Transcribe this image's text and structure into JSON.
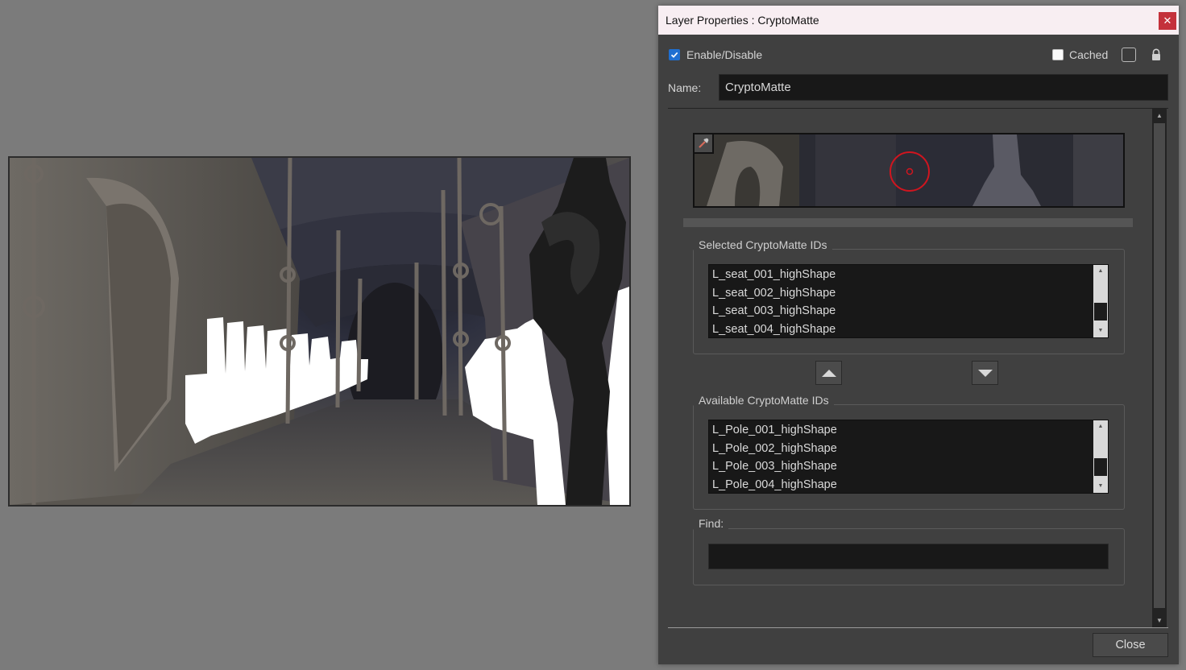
{
  "dialog": {
    "title": "Layer Properties : CryptoMatte",
    "enable_label": "Enable/Disable",
    "enable_checked": true,
    "cached_label": "Cached",
    "cached_checked": false,
    "name_label": "Name:",
    "name_value": "CryptoMatte",
    "selected_group_title": "Selected CryptoMatte IDs",
    "selected_ids": [
      "L_seat_001_highShape",
      "L_seat_002_highShape",
      "L_seat_003_highShape",
      "L_seat_004_highShape"
    ],
    "available_group_title": "Available CryptoMatte IDs",
    "available_ids": [
      "L_Pole_001_highShape",
      "L_Pole_002_highShape",
      "L_Pole_003_highShape",
      "L_Pole_004_highShape"
    ],
    "find_label": "Find:",
    "find_value": "",
    "close_label": "Close"
  },
  "icons": {
    "titlebar_close": "close-icon",
    "lock": "lock-icon",
    "picker": "eyedropper-icon",
    "move_up": "triangle-up-icon",
    "move_down": "triangle-down-icon"
  },
  "colors": {
    "accent": "#1f6fd1",
    "close_red": "#c4313b",
    "picker_target": "#d0151f"
  }
}
